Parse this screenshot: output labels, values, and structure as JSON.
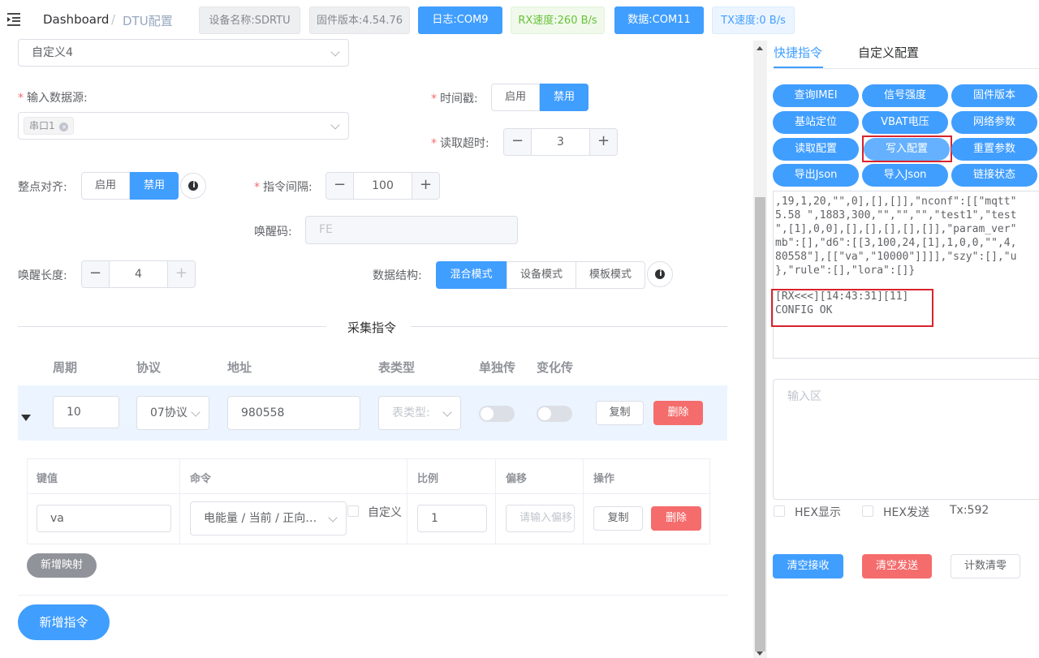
{
  "header": {
    "menu_icon": "menu-fold-icon",
    "breadcrumb_home": "Dashboard",
    "breadcrumb_sep": "/",
    "breadcrumb_current": "DTU配置",
    "tags": {
      "device": "设备名称:SDRTU",
      "firmware": "固件版本:4.54.76",
      "log": "日志:COM9",
      "rx": "RX速度:260 B/s",
      "data": "数据:COM11",
      "tx": "TX速度:0 B/s"
    }
  },
  "form": {
    "custom_select": "自定义4",
    "input_source_label": "输入数据源:",
    "input_source_tag": "串口1",
    "timestamp_label": "时间戳:",
    "enable": "启用",
    "disable": "禁用",
    "read_timeout_label": "读取超时:",
    "read_timeout_value": "3",
    "align_label": "整点对齐:",
    "interval_label": "指令间隔:",
    "interval_value": "100",
    "wake_code_label": "唤醒码:",
    "wake_code_placeholder": "FE",
    "wake_len_label": "唤醒长度:",
    "wake_len_value": "4",
    "struct_label": "数据结构:",
    "struct_modes": [
      "混合模式",
      "设备模式",
      "模板模式"
    ],
    "info_glyph": "i",
    "minus": "−",
    "plus": "+"
  },
  "collect": {
    "title": "采集指令",
    "headers": [
      "周期",
      "协议",
      "地址",
      "表类型",
      "单独传",
      "变化传"
    ],
    "row": {
      "period": "10",
      "protocol": "07协议",
      "address": "980558",
      "meter_type_placeholder": "表类型:",
      "copy": "复制",
      "delete": "删除"
    },
    "map_headers": [
      "键值",
      "命令",
      "比例",
      "偏移",
      "操作"
    ],
    "map_row": {
      "key": "va",
      "command": "电能量 / 当前 / 正向有功",
      "custom_label": "自定义",
      "ratio": "1",
      "offset_placeholder": "请输入偏移",
      "copy": "复制",
      "delete": "删除"
    },
    "add_map": "新增映射",
    "add_cmd": "新增指令"
  },
  "right": {
    "tabs": [
      "快捷指令",
      "自定义配置"
    ],
    "quick_buttons": [
      "查询IMEI",
      "信号强度",
      "固件版本",
      "基站定位",
      "VBAT电压",
      "网络参数",
      "读取配置",
      "写入配置",
      "重置参数",
      "导出Json",
      "导入Json",
      "链接状态"
    ],
    "log_lines": [
      ",19,1,20,\"\",0],[],[]],\"nconf\":[[\"mqtt\"",
      "5.58 \",1883,300,\"\",\"\",\"\",\"test1\",\"test",
      "\",[1],0,0],[],[],[],[],[]],\"param_ver\"",
      "mb\":[],\"d6\":[[3,100,24,[1],1,0,0,\"\",4,",
      "80558\"],[[\"va\",\"10000\"]]]],\"szy\":[],\"u",
      "},\"rule\":[],\"lora\":[]}"
    ],
    "rx_line": "[RX<<<][14:43:31][11]",
    "rx_msg": "CONFIG OK",
    "input_placeholder": "输入区",
    "hex_show": "HEX显示",
    "hex_send": "HEX发送",
    "tx_count": "Tx:592",
    "clear_rx": "清空接收",
    "clear_tx": "清空发送",
    "reset_count": "计数清零"
  },
  "colors": {
    "primary": "#409eff",
    "danger": "#f56c6c",
    "highlight": "#d9232d"
  }
}
